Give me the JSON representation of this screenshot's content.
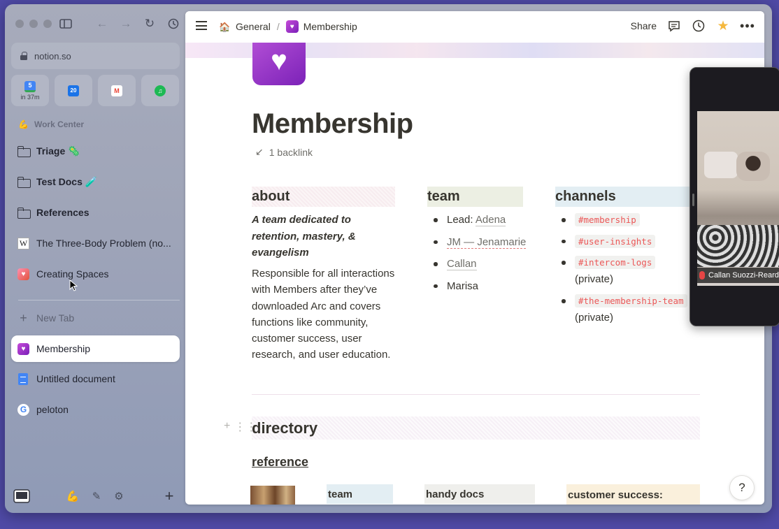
{
  "browser": {
    "url": "notion.so",
    "favorites": [
      {
        "name": "google-calendar",
        "label": "5",
        "caption": "in 37m"
      },
      {
        "name": "calendar-app",
        "label": "20",
        "caption": ""
      },
      {
        "name": "gmail",
        "label": "M",
        "caption": ""
      },
      {
        "name": "spotify",
        "label": "♫",
        "caption": ""
      }
    ],
    "space_label": "Work Center",
    "pinned": [
      {
        "label": "Triage 🦠",
        "type": "folder"
      },
      {
        "label": "Test Docs 🧪",
        "type": "folder"
      },
      {
        "label": "References",
        "type": "folder"
      },
      {
        "label": "The Three-Body Problem (no...",
        "type": "wikipedia"
      },
      {
        "label": "Creating Spaces",
        "type": "pink"
      }
    ],
    "new_tab": "New Tab",
    "tabs": [
      {
        "label": "Membership",
        "active": true
      },
      {
        "label": "Untitled document",
        "active": false
      },
      {
        "label": "peloton",
        "active": false
      }
    ]
  },
  "notion": {
    "breadcrumb": {
      "parent": "General",
      "current": "Membership"
    },
    "share": "Share",
    "title": "Membership",
    "backlink": "1 backlink",
    "about": {
      "heading": "about",
      "tagline": "A team dedicated to retention, mastery, & evangelism",
      "description": "Responsible for all interactions with Members after they’ve downloaded Arc and covers functions like community, customer success, user research, and user education."
    },
    "team": {
      "heading": "team",
      "lead_prefix": "Lead: ",
      "lead_name": "Adena",
      "member2": "JM — Jenamarie",
      "member3": "Callan",
      "member4": "Marisa"
    },
    "channels": {
      "heading": "channels",
      "c1": "#membership",
      "c2": "#user-insights",
      "c3": "#intercom-logs",
      "c3_note": "(private)",
      "c4": "#the-membership-team",
      "c4_note": "(private)"
    },
    "directory": "directory",
    "reference": "reference",
    "sub_team": "team",
    "sub_docs": "handy docs",
    "sub_cs": "customer success: onboarding",
    "help": "?"
  },
  "video": {
    "participant": "Callan Suozzi-Reardon"
  },
  "colors": {
    "accent": "#7c22b8",
    "code": "#eb5757",
    "background": "#4f4aa6"
  }
}
